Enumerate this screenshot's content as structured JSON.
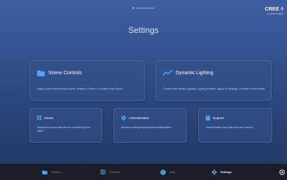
{
  "status": {
    "text": "STATUS OK"
  },
  "logo": {
    "line1": "CREE ◊",
    "line2": "LIGHTING"
  },
  "page": {
    "title": "Settings"
  },
  "cards": {
    "scene": {
      "title": "Scene Controls",
      "desc": "Adjust Scene controls and Zones, rename a Scene, or create a new Scene.",
      "icon": "folder-icon",
      "color": "#4ea3f2"
    },
    "dynamic": {
      "title": "Dynamic Lighting",
      "desc": "Choose from preset Dynamic Lighting Profiles, adjust DL settings, or create a new Profile.",
      "icon": "trend-line-icon",
      "color": "#4ea3f2"
    },
    "zones": {
      "title": "Zones",
      "desc": "Display the Zones that can be controlled by this tablet.",
      "icon": "grid-icon",
      "color": "#4ea3f2"
    },
    "admin": {
      "title": "Administration",
      "desc": "Advance settings and systems administration.",
      "icon": "gear-icon",
      "color": "#4ea3f2"
    },
    "support": {
      "title": "Support",
      "desc": "Administrative help desk and user manual.",
      "icon": "book-icon",
      "color": "#4ea3f2"
    }
  },
  "tabbar": {
    "tabs": [
      {
        "label": "Scenes",
        "icon": "folder-icon"
      },
      {
        "label": "Controls",
        "icon": "sliders-icon"
      },
      {
        "label": "Help",
        "icon": "help-circle-icon"
      },
      {
        "label": "Settings",
        "icon": "gear-icon",
        "active": true
      }
    ]
  }
}
